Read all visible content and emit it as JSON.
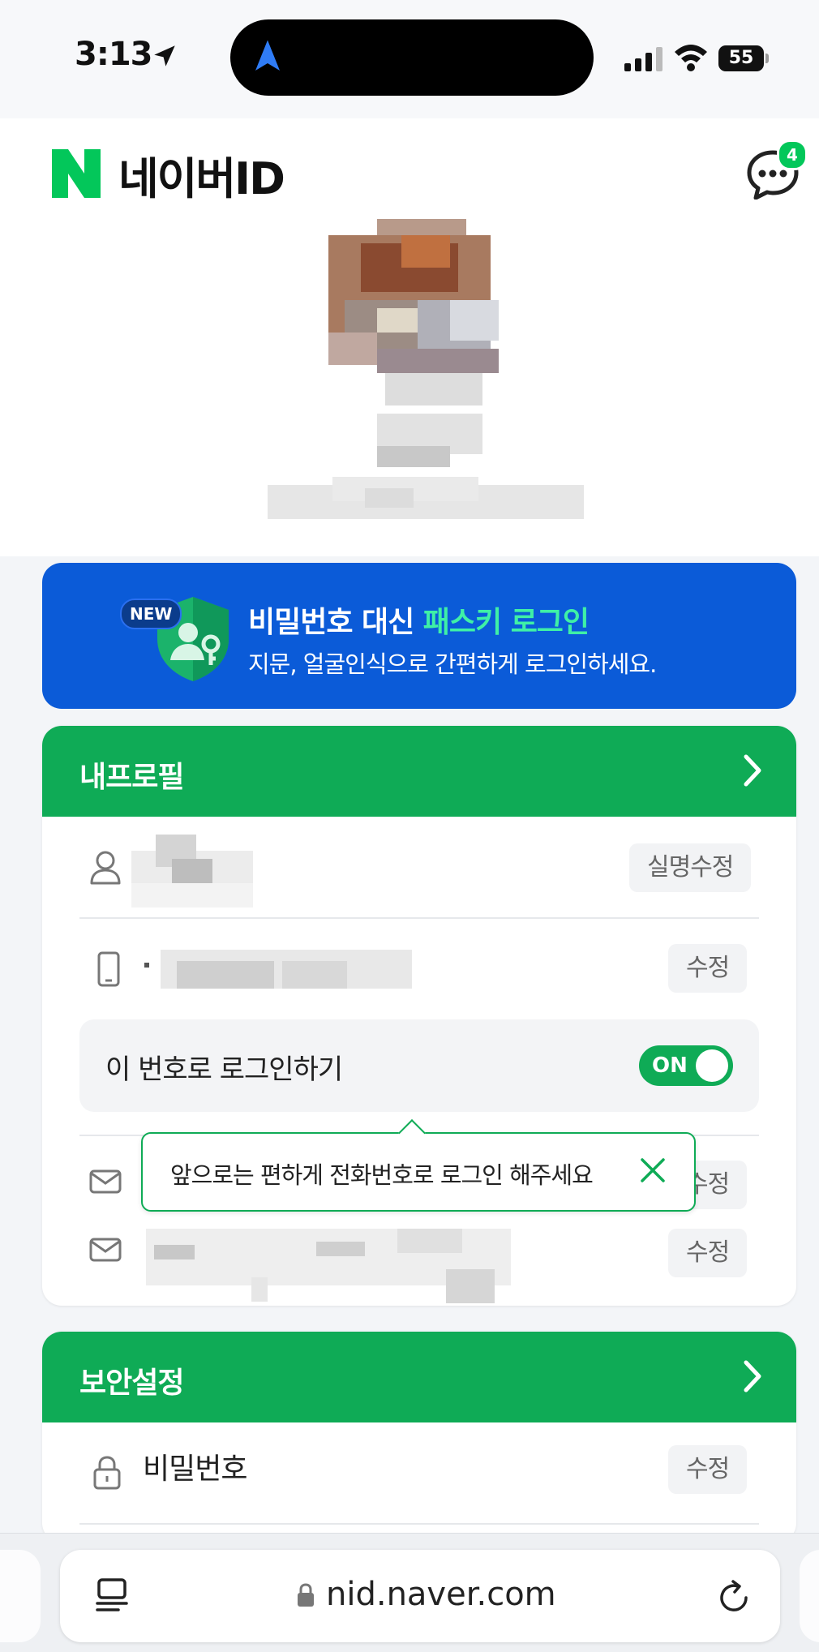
{
  "status_bar": {
    "time": "3:13",
    "battery": "55"
  },
  "header": {
    "logo_text": "네이버ID",
    "chat_badge": "4"
  },
  "passkey_banner": {
    "badge": "NEW",
    "title_prefix": "비밀번호 대신 ",
    "title_highlight": "패스키 로그인",
    "subtitle": "지문, 얼굴인식으로 간편하게 로그인하세요."
  },
  "profile_card": {
    "title": "내프로필",
    "name_action": "실명수정",
    "phone_action": "수정",
    "login_toggle_label": "이 번호로 로그인하기",
    "login_toggle_state": "ON",
    "email1_action": "수정",
    "email2_action": "수정"
  },
  "tooltip": {
    "text": "앞으로는 편하게 전화번호로 로그인 해주세요"
  },
  "security_card": {
    "title": "보안설정",
    "password_label": "비밀번호",
    "password_action": "수정"
  },
  "browser": {
    "url": "nid.naver.com"
  },
  "colors": {
    "naver_green": "#03c75a",
    "card_green": "#0fab56",
    "passkey_blue": "#0b5bd8",
    "passkey_highlight": "#3ff0a6"
  }
}
